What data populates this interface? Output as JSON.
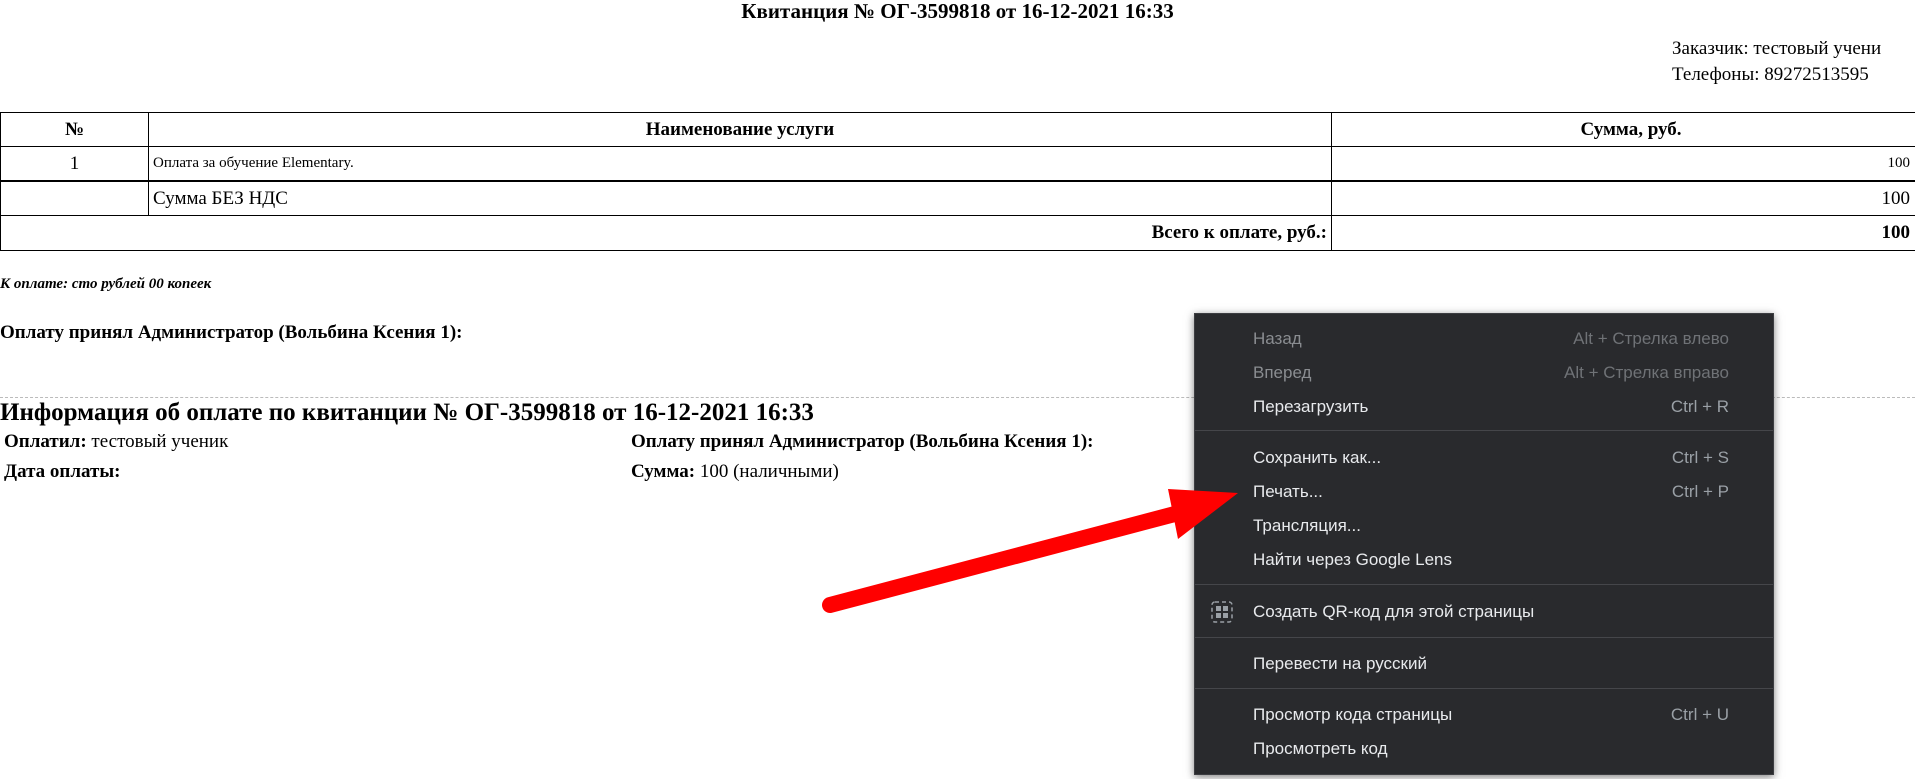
{
  "receipt": {
    "title": "Квитанция № ОГ-3599818 от 16-12-2021 16:33",
    "customer_line": "Заказчик: тестовый учени",
    "phones_line": "Телефоны: 89272513595",
    "table": {
      "headers": [
        "№",
        "Наименование услуги",
        "Сумма, руб."
      ],
      "rows": [
        {
          "num": "1",
          "service": "Оплата за обучение Elementary.",
          "amount": "100"
        }
      ],
      "subtotal_label": "Сумма БЕЗ НДС",
      "subtotal_value": "100",
      "total_label": "Всего к оплате, руб.:",
      "total_value": "100"
    },
    "amount_words": "К оплате: сто рублей 00 копеек",
    "accepted_by": "Оплату принял Администратор (Вольбина Ксения 1):"
  },
  "payment_info": {
    "title": "Информация об оплате по квитанции № ОГ-3599818 от 16-12-2021 16:33",
    "payer_label": "Оплатил:",
    "payer_value": "тестовый ученик",
    "date_label": "Дата оплаты:",
    "accepted_label": "Оплату принял Администратор (Вольбина Ксения 1):",
    "sum_label": "Сумма:",
    "sum_value": "100 (наличными)"
  },
  "context_menu": {
    "back": {
      "label": "Назад",
      "shortcut": "Alt + Стрелка влево"
    },
    "forward": {
      "label": "Вперед",
      "shortcut": "Alt + Стрелка вправо"
    },
    "reload": {
      "label": "Перезагрузить",
      "shortcut": "Ctrl + R"
    },
    "save_as": {
      "label": "Сохранить как...",
      "shortcut": "Ctrl + S"
    },
    "print": {
      "label": "Печать...",
      "shortcut": "Ctrl + P"
    },
    "cast": {
      "label": "Трансляция..."
    },
    "google_lens": {
      "label": "Найти через Google Lens"
    },
    "qr_code": {
      "label": "Создать QR-код для этой страницы",
      "icon": "qr-code-icon"
    },
    "translate": {
      "label": "Перевести на русский"
    },
    "view_source": {
      "label": "Просмотр кода страницы",
      "shortcut": "Ctrl + U"
    },
    "inspect": {
      "label": "Просмотреть код"
    }
  },
  "colors": {
    "menu_bg": "#292a2d",
    "menu_text": "#e8eaed",
    "arrow": "#ff0000"
  }
}
